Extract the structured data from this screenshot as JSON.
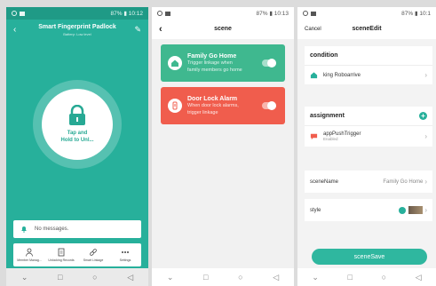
{
  "status": {
    "p1_time": "10:12",
    "p2_time": "10:13",
    "p3_time": "10:1",
    "battery": "87%"
  },
  "panel1": {
    "title": "Smart Fingerprint Padlock",
    "subtitle": "Battery: Low level",
    "lock_text_line1": "Tap and",
    "lock_text_line2": "Hold to Unl...",
    "messages": "No messages.",
    "toolbar": [
      {
        "label": "Member Manag...",
        "icon": "person-icon"
      },
      {
        "label": "Unlocking Records",
        "icon": "document-icon"
      },
      {
        "label": "Smart Linkage",
        "icon": "link-icon"
      },
      {
        "label": "Settings",
        "icon": "more-icon"
      }
    ]
  },
  "panel2": {
    "title": "scene",
    "cards": [
      {
        "title": "Family Go Home",
        "desc1": "Trigger linkage when",
        "desc2": "family members go home",
        "color": "#3fb88f"
      },
      {
        "title": "Door Lock Alarm",
        "desc1": "When door lock alarms,",
        "desc2": "trigger linkage",
        "color": "#f05d4d"
      }
    ]
  },
  "panel3": {
    "cancel": "Cancel",
    "title": "sceneEdit",
    "condition_label": "condition",
    "condition_item": "king Roboarrive",
    "assignment_label": "assignment",
    "assignment_item": "appPushTrigger",
    "assignment_status": "Enabled",
    "scene_name_label": "sceneName",
    "scene_name_value": "Family Go Home",
    "style_label": "style",
    "save": "sceneSave"
  },
  "colors": {
    "teal": "#27b09b",
    "green_card": "#3fb88f",
    "red_card": "#f05d4d"
  }
}
